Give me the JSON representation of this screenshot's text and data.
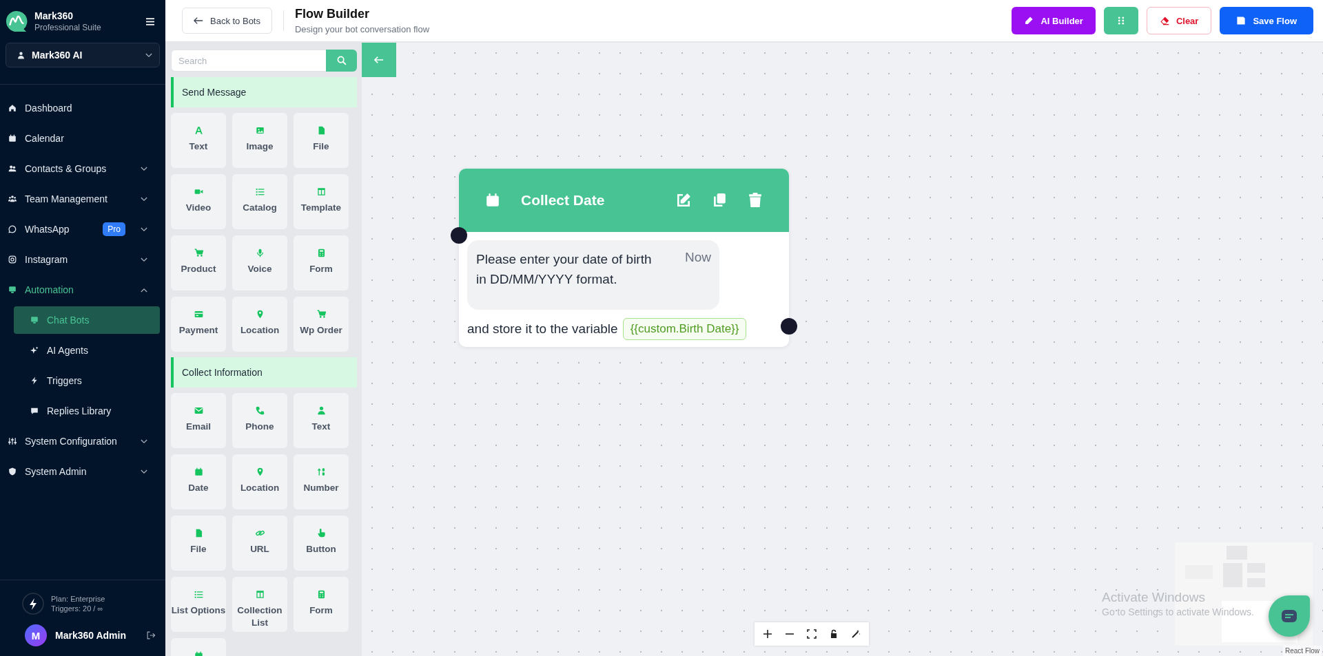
{
  "brand": {
    "name": "Mark360",
    "subtitle": "Professional Suite"
  },
  "workspace": {
    "label": "Mark360 AI"
  },
  "nav": [
    {
      "label": "Dashboard",
      "selected": false
    },
    {
      "label": "Calendar",
      "selected": false
    },
    {
      "label": "Contacts & Groups",
      "expanded": false,
      "selected": false
    },
    {
      "label": "Team Management",
      "expanded": false,
      "selected": false
    },
    {
      "label": "WhatsApp",
      "badge": "Pro",
      "expanded": false,
      "selected": false
    },
    {
      "label": "Instagram",
      "expanded": false,
      "selected": false
    },
    {
      "label": "Automation",
      "expanded": true,
      "selected": true,
      "children": [
        {
          "label": "Chat Bots",
          "selected": true
        },
        {
          "label": "AI Agents",
          "selected": false
        },
        {
          "label": "Triggers",
          "selected": false
        },
        {
          "label": "Replies Library",
          "selected": false
        }
      ]
    },
    {
      "label": "System Configuration",
      "expanded": false,
      "selected": false
    },
    {
      "label": "System Admin",
      "expanded": false,
      "selected": false
    }
  ],
  "plan": {
    "line_1": "Plan: Enterprise",
    "line_2": "Triggers: 20 / ∞"
  },
  "user": {
    "initial": "M",
    "name": "Mark360 Admin"
  },
  "header": {
    "back": "Back to Bots",
    "title": "Flow Builder",
    "subtitle": "Design your bot conversation flow",
    "buttons": [
      {
        "label": "AI Builder",
        "kind": "ai"
      },
      {
        "kind": "grid"
      },
      {
        "label": "Clear",
        "kind": "clear"
      },
      {
        "label": "Save Flow",
        "kind": "save"
      }
    ]
  },
  "palette": {
    "search": {
      "placeholder": "Search"
    },
    "sections": [
      {
        "title": "Send Message",
        "items": [
          {
            "label": "Text"
          },
          {
            "label": "Image"
          },
          {
            "label": "File"
          },
          {
            "label": "Video"
          },
          {
            "label": "Catalog"
          },
          {
            "label": "Template"
          },
          {
            "label": "Product"
          },
          {
            "label": "Voice"
          },
          {
            "label": "Form"
          },
          {
            "label": "Payment"
          },
          {
            "label": "Location"
          },
          {
            "label": "Wp Order"
          }
        ]
      },
      {
        "title": "Collect Information",
        "items": [
          {
            "label": "Email"
          },
          {
            "label": "Phone"
          },
          {
            "label": "Text"
          },
          {
            "label": "Date"
          },
          {
            "label": "Location"
          },
          {
            "label": "Number"
          },
          {
            "label": "File"
          },
          {
            "label": "URL"
          },
          {
            "label": "Button"
          },
          {
            "label": "List Options"
          },
          {
            "label": "Collection List"
          },
          {
            "label": "Form"
          }
        ]
      }
    ]
  },
  "node": {
    "title": "Collect Date",
    "message": "Please enter your date of birth in DD/MM/YYYY format.",
    "time": "Now",
    "store_text": "and store it to the variable",
    "variable": "{{custom.Birth Date}}"
  },
  "attribution": "React Flow",
  "os_overlay": {
    "title": "Activate Windows",
    "text": "Go to Settings to activate Windows."
  }
}
